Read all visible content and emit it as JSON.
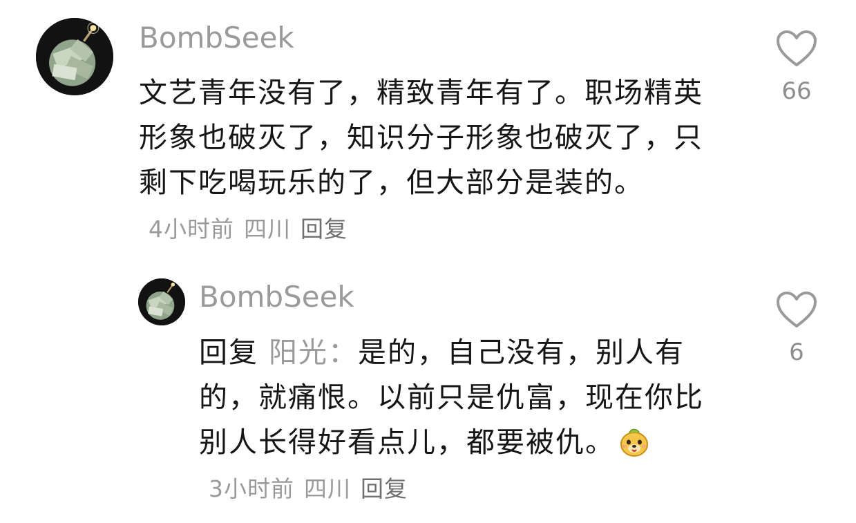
{
  "comments": [
    {
      "username": "BombSeek",
      "avatar_icon": "money-bomb-avatar",
      "text": "文艺青年没有了，精致青年有了。职场精英形象也破灭了，知识分子形象也破灭了，只剩下吃喝玩乐的了，但大部分是装的。",
      "time": "4小时前",
      "location": "四川",
      "reply_label": "回复",
      "likes": "66"
    }
  ],
  "replies": [
    {
      "username": "BombSeek",
      "avatar_icon": "money-bomb-avatar",
      "reply_prefix": "回复",
      "reply_target": "阳光：",
      "text": "是的，自己没有，别人有的，就痛恨。以前只是仇富，现在你比别人长得好看点儿，都要被仇。",
      "emoji": "puppy-face-emoji",
      "time": "3小时前",
      "location": "四川",
      "reply_label": "回复",
      "likes": "6"
    }
  ],
  "colors": {
    "username": "#9a9a9a",
    "text": "#161616",
    "meta": "#9a9a9a",
    "heart_outline": "#9a9a9a"
  }
}
